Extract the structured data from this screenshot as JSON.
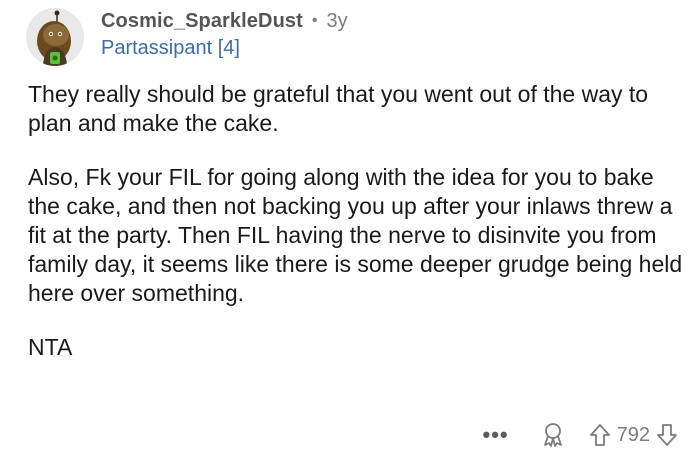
{
  "comment": {
    "username": "Cosmic_SparkleDust",
    "separator": "•",
    "age": "3y",
    "flair": "Partassipant [4]",
    "paragraphs": [
      "They really should be grateful that you went out of the way to plan and make the cake.",
      "Also, Fk your FIL for going along with the idea for you to bake the cake, and then not backing you up after your inlaws threw a fit at the party. Then FIL having the nerve to disinvite you from family day, it seems like there is some deeper grudge being held here over something.",
      "NTA"
    ],
    "actions": {
      "more_label": "•••",
      "award_icon": "award-icon",
      "upvote_icon": "upvote-arrow-icon",
      "vote_count": "792",
      "downvote_icon": "downvote-arrow-icon"
    }
  },
  "colors": {
    "username": "#555555",
    "flair": "#3b6ea5",
    "meta": "#7c7c7c",
    "text": "#1a1a1b"
  }
}
